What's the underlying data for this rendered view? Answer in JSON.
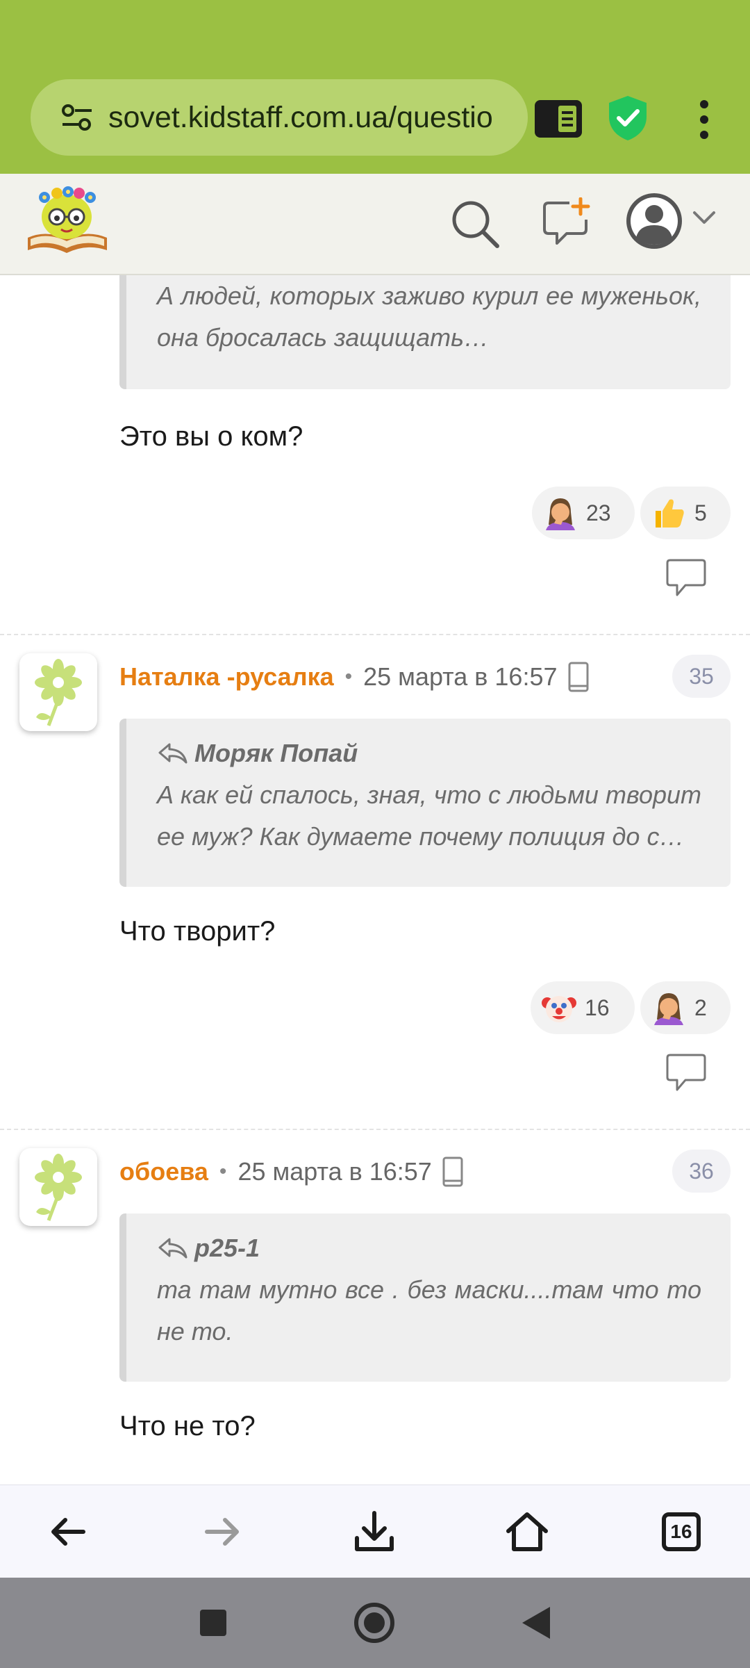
{
  "browser": {
    "url": "sovet.kidstaff.com.ua/questio",
    "tabs_count": "16"
  },
  "icons": {
    "site_settings": "tune-icon",
    "reader": "reader-mode-icon",
    "shield": "shield-check-icon",
    "menu": "more-vert-icon",
    "search": "search-icon",
    "new_topic": "add-comment-icon",
    "profile": "avatar-icon",
    "reply": "reply-icon",
    "device": "phone-icon"
  },
  "colors": {
    "chrome": "#9bc043",
    "author": "#e67e12",
    "shield": "#22c55e"
  },
  "posts": [
    {
      "quote_text": "А людей, которых заживо курил ее муженьок, она бросалась защищать…",
      "body": "Это вы о ком?",
      "reactions": [
        {
          "emoji": "facepalm",
          "count": "23"
        },
        {
          "emoji": "thumbs-up",
          "count": "5"
        }
      ]
    },
    {
      "author": "Наталка -русалка",
      "date": "25 марта в 16:57",
      "number": "35",
      "quote_author": "Моряк Попай",
      "quote_text": "А как ей спалось, зная, что с людьми творит ее муж? Как думаете почему полиция до с…",
      "body": "Что творит?",
      "reactions": [
        {
          "emoji": "clown",
          "count": "16"
        },
        {
          "emoji": "facepalm",
          "count": "2"
        }
      ]
    },
    {
      "author": "обоева",
      "date": "25 марта в 16:57",
      "number": "36",
      "quote_author": "р25-1",
      "quote_text": "та там мутно все . без маски....там что то не то.",
      "body": "Что не то?"
    }
  ]
}
